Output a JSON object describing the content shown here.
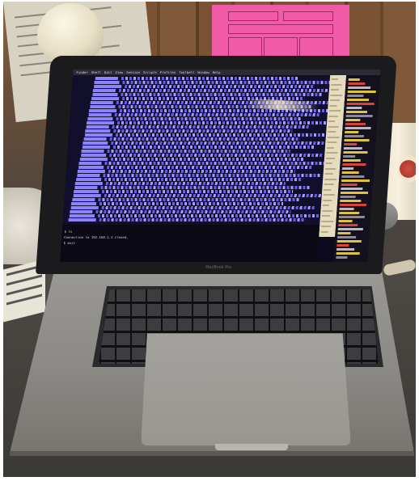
{
  "scene": {
    "menubar_items": [
      "Finder",
      "Shell",
      "Edit",
      "View",
      "Session",
      "Scripts",
      "Profiles",
      "Toolbelt",
      "Window",
      "Help"
    ],
    "bezel_label": "MacBook Pro",
    "terminal_bottom_lines": [
      "$ ls",
      "Connection to 192.168.1.1 closed.",
      "$ exit"
    ]
  }
}
